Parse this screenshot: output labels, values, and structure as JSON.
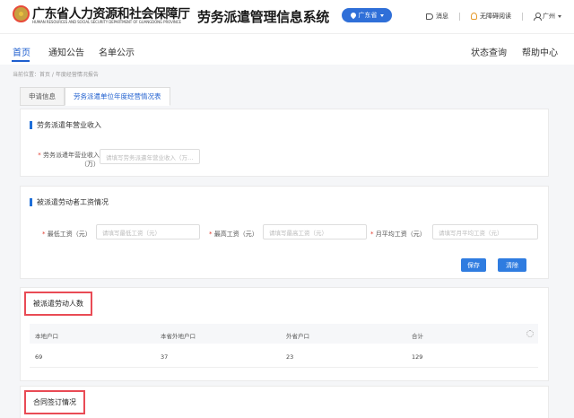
{
  "header": {
    "org_name": "广东省人力资源和社会保障厅",
    "org_name_en": "HUMAN RESOURCES AND SOCIAL SECURITY DEPARTMENT OF GUANGDONG PROVINCE",
    "system_title": "劳务派遣管理信息系统",
    "region": "广东省",
    "actions": {
      "messages": "消息",
      "guide": "无障碍阅读",
      "user": "广州"
    }
  },
  "nav": {
    "home": "首页",
    "notices": "通知公告",
    "list": "名单公示",
    "query": "状态查询",
    "help": "帮助中心"
  },
  "breadcrumb": "当前位置：首页  /  年度经营情况报告",
  "tabs": [
    "申请信息",
    "劳务派遣单位年度经营情况表"
  ],
  "revenue": {
    "title": "劳务派遣年营业收入",
    "label": "劳务派遣年营业收入（万）",
    "placeholder": "请填写劳务派遣年营业收入（万…"
  },
  "wages": {
    "title": "被派遣劳动者工资情况",
    "min_label": "最低工资（元）",
    "min_placeholder": "请填写最低工资（元）",
    "max_label": "最高工资（元）",
    "max_placeholder": "请填写最高工资（元）",
    "avg_label": "月平均工资（元）",
    "avg_placeholder": "请填写月平均工资（元）",
    "save": "保存",
    "clear": "清除"
  },
  "workers": {
    "title": "被派遣劳动人数",
    "columns": [
      "本地户口",
      "本省外地户口",
      "外省户口",
      "合计"
    ],
    "values": [
      "69",
      "37",
      "23",
      "129"
    ]
  },
  "contract": {
    "title": "合同签订情况"
  }
}
